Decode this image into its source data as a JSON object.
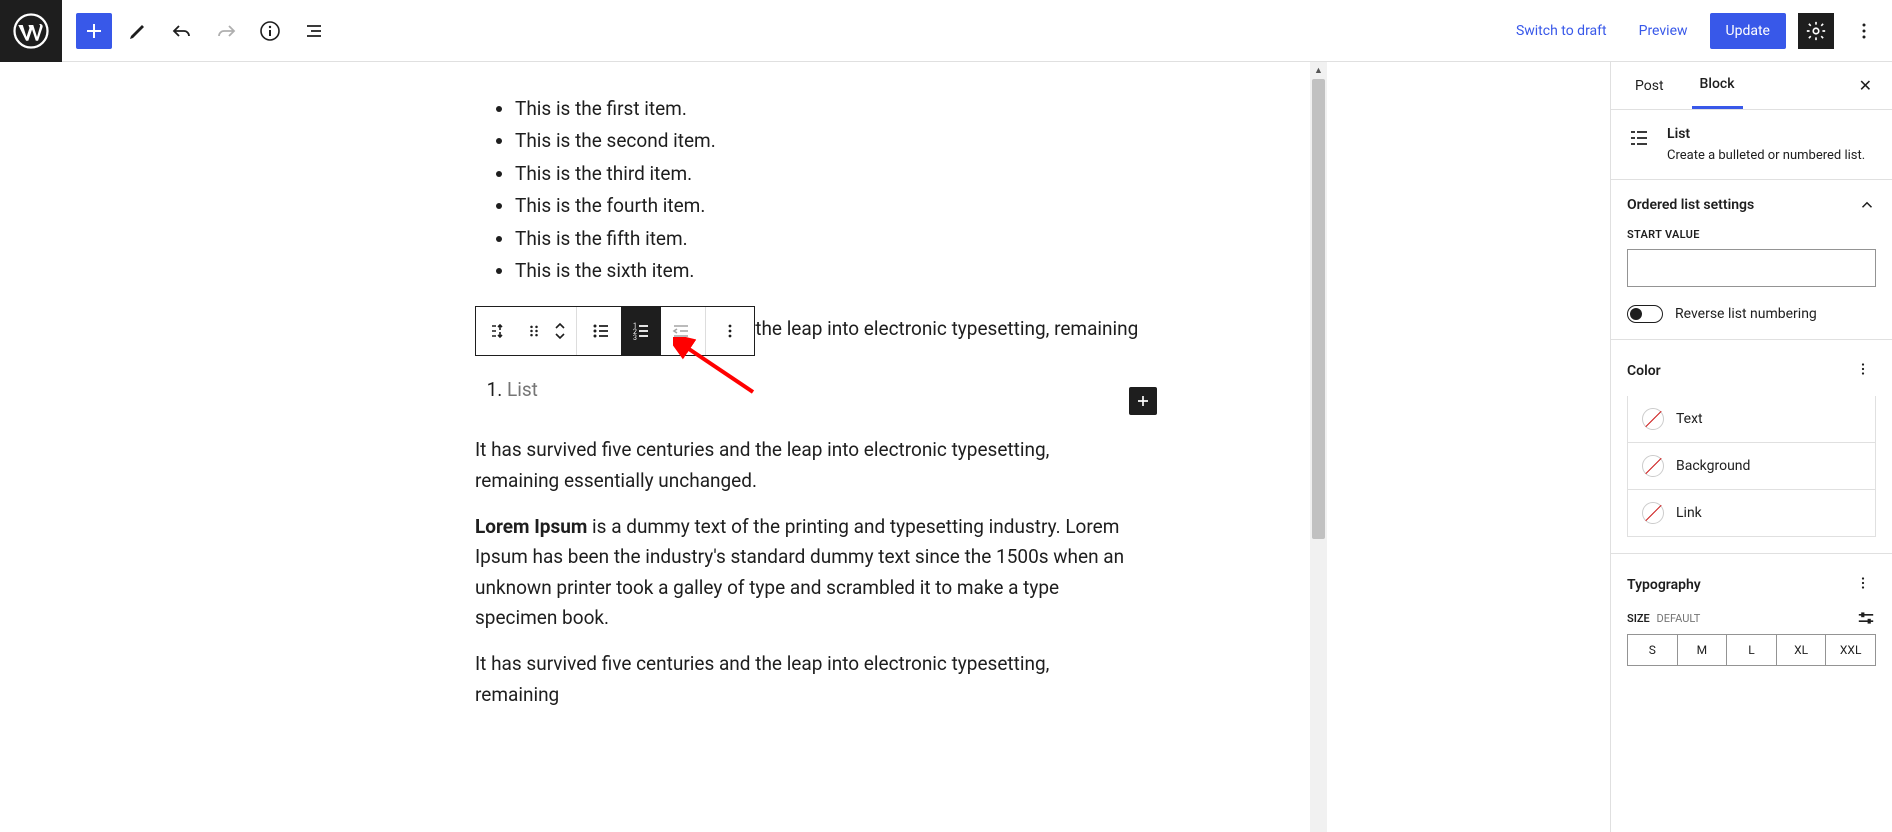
{
  "topbar": {
    "switch_to_draft": "Switch to draft",
    "preview": "Preview",
    "update": "Update"
  },
  "content": {
    "list_items": [
      "This is the first item.",
      "This is the second item.",
      "This is the third item.",
      "This is the fourth item.",
      "This is the fifth item.",
      "This is the sixth item."
    ],
    "para1_clipped": "It has survived five centuries and the leap into electronic typesetting, remaining",
    "ol_placeholder": "List",
    "para2": "It has survived five centuries and the leap into electronic typesetting, remaining essentially unchanged.",
    "para3_prefix": "Lorem Ipsum",
    "para3_rest": " is a dummy text of the printing and typesetting industry. Lorem Ipsum has been the industry's standard dummy text since the 1500s when an unknown printer took a galley of type and scrambled it to make a type specimen book.",
    "para4": " It has survived five centuries and the leap into electronic typesetting, remaining"
  },
  "sidebar": {
    "tabs": {
      "post": "Post",
      "block": "Block"
    },
    "block_info": {
      "title": "List",
      "desc": "Create a bulleted or numbered list."
    },
    "ordered": {
      "heading": "Ordered list settings",
      "start_value_label": "START VALUE",
      "reverse_label": "Reverse list numbering"
    },
    "color": {
      "heading": "Color",
      "text": "Text",
      "background": "Background",
      "link": "Link"
    },
    "typography": {
      "heading": "Typography",
      "size_label": "SIZE",
      "size_default": "DEFAULT",
      "sizes": [
        "S",
        "M",
        "L",
        "XL",
        "XXL"
      ]
    }
  }
}
